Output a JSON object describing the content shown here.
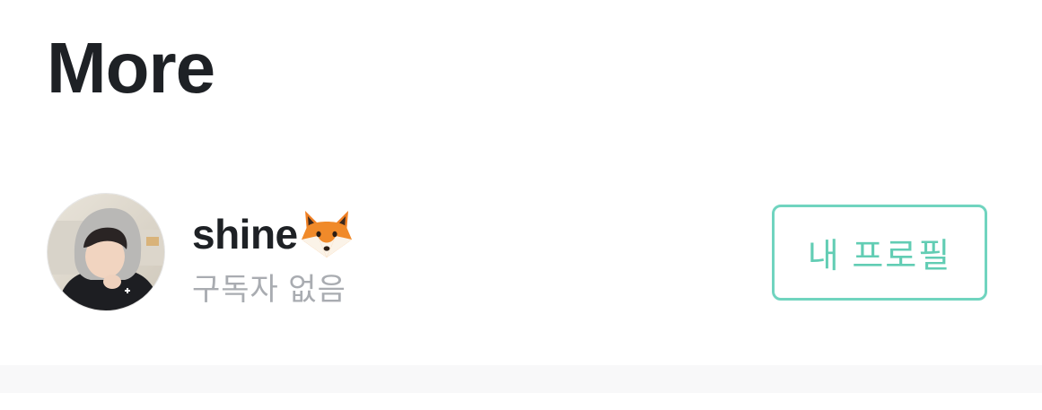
{
  "header": {
    "title": "More"
  },
  "profile": {
    "name": "shine",
    "name_emoji": "fox-face-icon",
    "subscribers": "구독자 없음",
    "avatar": "user-avatar-photo",
    "my_profile_button_label": "내 프로필"
  },
  "colors": {
    "accent": "#70d4bf",
    "title_text": "#1e2125",
    "muted_text": "#a9acb1",
    "divider": "#f8f8f9"
  }
}
